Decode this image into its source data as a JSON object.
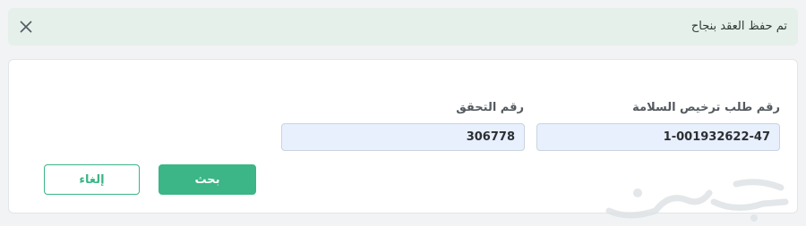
{
  "alert": {
    "message": "تم حفظ العقد بنجاح",
    "close_icon": "close-icon"
  },
  "form": {
    "safety_permit_label": "رقم طلب ترخيص السلامة",
    "safety_permit_value": "1-001932622-47",
    "verification_label": "رقم التحقق",
    "verification_value": "306778"
  },
  "actions": {
    "search_label": "بحث",
    "cancel_label": "إلغاء"
  },
  "watermark": {
    "icon": "haraj-logo-watermark"
  },
  "colors": {
    "accent": "#3cb587",
    "alert_bg": "#e5f0ea",
    "input_bg": "#e8f0fe"
  }
}
